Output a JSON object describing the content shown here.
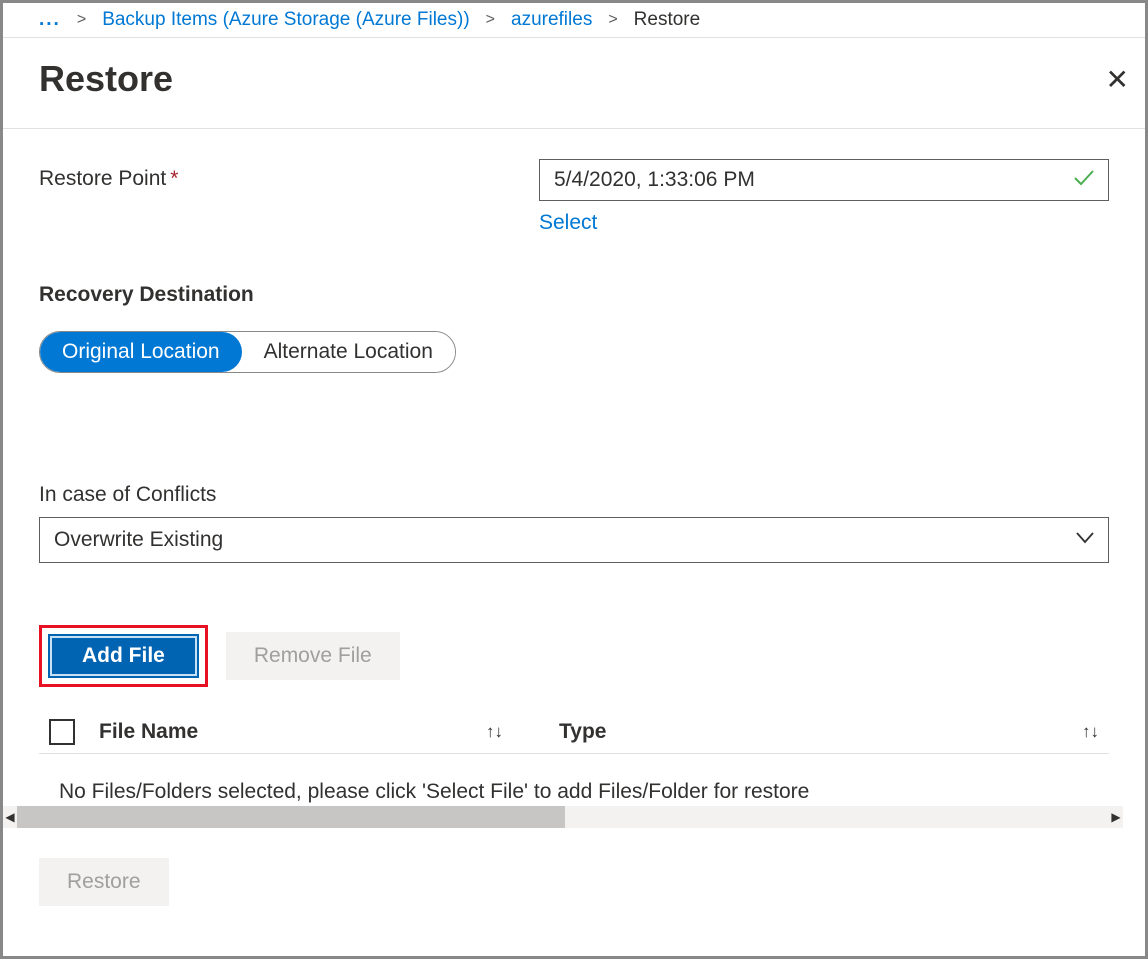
{
  "breadcrumb": {
    "ellipsis": "...",
    "items": [
      {
        "label": "Backup Items (Azure Storage (Azure Files))"
      },
      {
        "label": "azurefiles"
      }
    ],
    "current": "Restore"
  },
  "page": {
    "title": "Restore"
  },
  "restorePoint": {
    "label": "Restore Point",
    "value": "5/4/2020, 1:33:06 PM",
    "selectLink": "Select"
  },
  "recoveryDestination": {
    "label": "Recovery Destination",
    "options": {
      "original": "Original Location",
      "alternate": "Alternate Location"
    }
  },
  "conflicts": {
    "label": "In case of Conflicts",
    "value": "Overwrite Existing"
  },
  "fileActions": {
    "addFile": "Add File",
    "removeFile": "Remove File"
  },
  "table": {
    "columns": {
      "fileName": "File Name",
      "type": "Type"
    },
    "emptyMessage": "No Files/Folders selected, please click 'Select File' to add Files/Folder for restore"
  },
  "footer": {
    "restoreButton": "Restore"
  }
}
